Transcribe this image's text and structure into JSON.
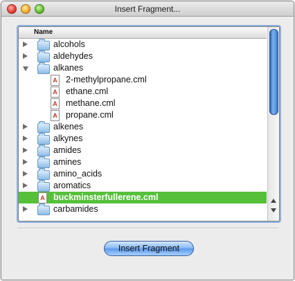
{
  "window": {
    "title": "Insert Fragment..."
  },
  "browser": {
    "column_header": "Name",
    "rows": [
      {
        "label": "alcohols",
        "kind": "folder",
        "state": "closed",
        "indent": 0
      },
      {
        "label": "aldehydes",
        "kind": "folder",
        "state": "closed",
        "indent": 0
      },
      {
        "label": "alkanes",
        "kind": "folder",
        "state": "open",
        "indent": 0
      },
      {
        "label": "2-methylpropane.cml",
        "kind": "file",
        "indent": 1
      },
      {
        "label": "ethane.cml",
        "kind": "file",
        "indent": 1
      },
      {
        "label": "methane.cml",
        "kind": "file",
        "indent": 1
      },
      {
        "label": "propane.cml",
        "kind": "file",
        "indent": 1
      },
      {
        "label": "alkenes",
        "kind": "folder",
        "state": "closed",
        "indent": 0
      },
      {
        "label": "alkynes",
        "kind": "folder",
        "state": "closed",
        "indent": 0
      },
      {
        "label": "amides",
        "kind": "folder",
        "state": "closed",
        "indent": 0
      },
      {
        "label": "amines",
        "kind": "folder",
        "state": "closed",
        "indent": 0
      },
      {
        "label": "amino_acids",
        "kind": "folder",
        "state": "closed",
        "indent": 0
      },
      {
        "label": "aromatics",
        "kind": "folder",
        "state": "closed",
        "indent": 0
      },
      {
        "label": "buckminsterfullerene.cml",
        "kind": "file",
        "indent": 0,
        "selected": true
      },
      {
        "label": "carbamides",
        "kind": "folder",
        "state": "closed",
        "indent": 0
      }
    ],
    "file_icon_glyph": "A",
    "selection_color": "#56c03b"
  },
  "buttons": {
    "insert": "Insert Fragment"
  }
}
